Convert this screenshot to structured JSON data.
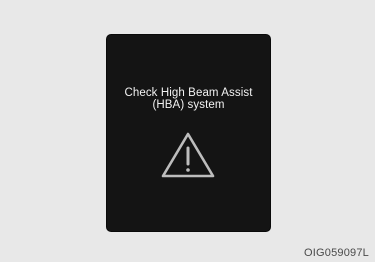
{
  "message": {
    "line1": "Check High Beam Assist",
    "line2": "(HBA) system"
  },
  "icon": "warning-triangle-icon",
  "figure_code": "OIG059097L",
  "colors": {
    "background": "#e8e8e8",
    "display": "#141414",
    "text": "#f2f2f2",
    "icon_stroke": "#bdbdbd"
  }
}
